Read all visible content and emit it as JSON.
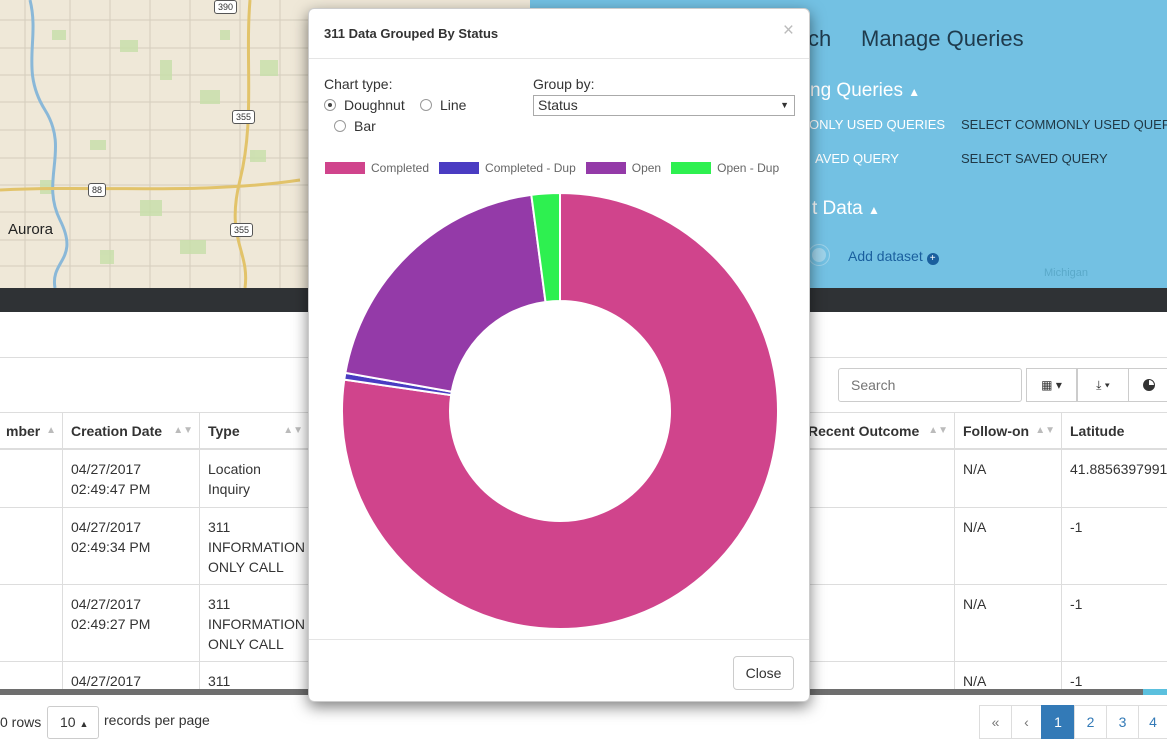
{
  "map": {
    "city_label": "Aurora",
    "highway_shields": [
      "390",
      "355",
      "88",
      "355"
    ]
  },
  "query_panel": {
    "nav_partial": "ch",
    "manage_queries": "Manage Queries",
    "existing_queries_partial": "ng Queries",
    "commonly_used_label_partial": "ONLY USED QUERIES",
    "commonly_used_value": "SELECT COMMONLY USED QUER",
    "saved_label_partial": "AVED QUERY",
    "saved_value": "SELECT SAVED QUERY",
    "data_section_partial": "t Data",
    "add_dataset": "Add dataset",
    "map_label": "Michigan"
  },
  "table": {
    "search_placeholder": "Search",
    "columns": [
      "mber",
      "Creation Date",
      "Type",
      "Recent Outcome",
      "Follow-on",
      "Latitude"
    ],
    "rows": [
      {
        "creation_date": "04/27/2017\n02:49:47 PM",
        "type": "Location\nInquiry",
        "follow_on": "N/A",
        "latitude": "41.8856397991"
      },
      {
        "creation_date": "04/27/2017\n02:49:34 PM",
        "type": "311\nINFORMATION\nONLY CALL",
        "follow_on": "N/A",
        "latitude": "-1"
      },
      {
        "creation_date": "04/27/2017\n02:49:27 PM",
        "type": "311\nINFORMATION\nONLY CALL",
        "follow_on": "N/A",
        "latitude": "-1"
      },
      {
        "creation_date": "04/27/2017",
        "type": "311",
        "follow_on": "N/A",
        "latitude": "-1"
      }
    ],
    "footer": {
      "rows_text": "0 rows",
      "page_size": "10",
      "records_per_page": "records per page",
      "pages": [
        "«",
        "‹",
        "1",
        "2",
        "3",
        "4"
      ],
      "active_page": "1"
    }
  },
  "modal": {
    "title": "311 Data Grouped By Status",
    "close_x": "×",
    "chart_type_label": "Chart type:",
    "chart_types": [
      {
        "label": "Doughnut",
        "selected": true
      },
      {
        "label": "Line",
        "selected": false
      },
      {
        "label": "Bar",
        "selected": false
      }
    ],
    "group_by_label": "Group by:",
    "group_by_value": "Status",
    "close_button": "Close"
  },
  "chart_data": {
    "type": "pie",
    "variant": "doughnut",
    "labels": [
      "Completed",
      "Completed - Dup",
      "Open",
      "Open - Dup"
    ],
    "values": [
      77.3,
      0.5,
      20.1,
      2.1
    ],
    "colors": [
      "#d0448c",
      "#4a3cc2",
      "#943aa8",
      "#2ef050"
    ],
    "legend_position": "top"
  }
}
